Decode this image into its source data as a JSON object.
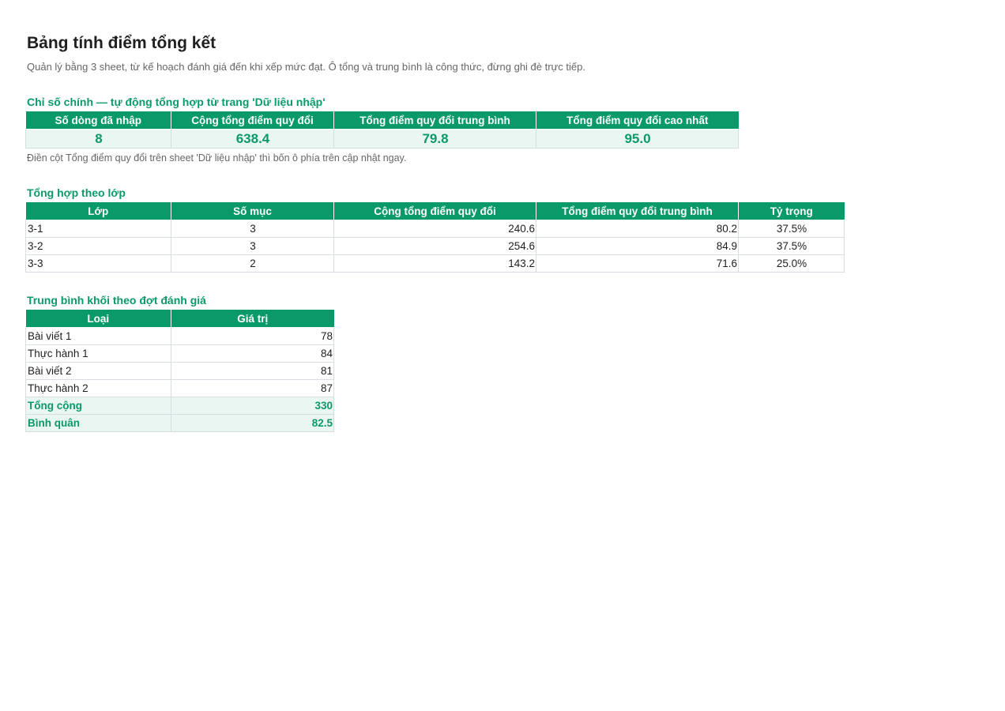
{
  "page": {
    "title": "Bảng tính điểm tổng kết",
    "subtitle": "Quản lý bằng 3 sheet, từ kế hoạch đánh giá đến khi xếp mức đạt. Ô tổng và trung bình là công thức, đừng ghi đè trực tiếp."
  },
  "kpi": {
    "section_title": "Chỉ số chính — tự động tổng hợp từ trang 'Dữ liệu nhập'",
    "headers": [
      "Số dòng đã nhập",
      "Cộng tổng điểm quy đổi",
      "Tổng điểm quy đổi trung bình",
      "Tổng điểm quy đổi cao nhất"
    ],
    "values": [
      "8",
      "638.4",
      "79.8",
      "95.0"
    ],
    "note": "Điền cột Tổng điểm quy đổi trên sheet 'Dữ liệu nhập' thì bốn ô phía trên cập nhật ngay."
  },
  "by_class": {
    "section_title": "Tổng hợp theo lớp",
    "headers": [
      "Lớp",
      "Số mục",
      "Cộng tổng điểm quy đổi",
      "Tổng điểm quy đổi trung bình",
      "Tỷ trọng"
    ],
    "rows": [
      [
        "3-1",
        "3",
        "240.6",
        "80.2",
        "37.5%"
      ],
      [
        "3-2",
        "3",
        "254.6",
        "84.9",
        "37.5%"
      ],
      [
        "3-3",
        "2",
        "143.2",
        "71.6",
        "25.0%"
      ]
    ]
  },
  "by_round": {
    "section_title": "Trung bình khối theo đợt đánh giá",
    "headers": [
      "Loại",
      "Giá trị"
    ],
    "rows": [
      [
        "Bài viết 1",
        "78"
      ],
      [
        "Thực hành 1",
        "84"
      ],
      [
        "Bài viết 2",
        "81"
      ],
      [
        "Thực hành 2",
        "87"
      ]
    ],
    "total": [
      "Tổng cộng",
      "330"
    ],
    "average": [
      "Bình quân",
      "82.5"
    ]
  },
  "colors": {
    "accent": "#0a9a6a",
    "accent_light": "#eaf6f1",
    "border": "#d8dde3"
  }
}
